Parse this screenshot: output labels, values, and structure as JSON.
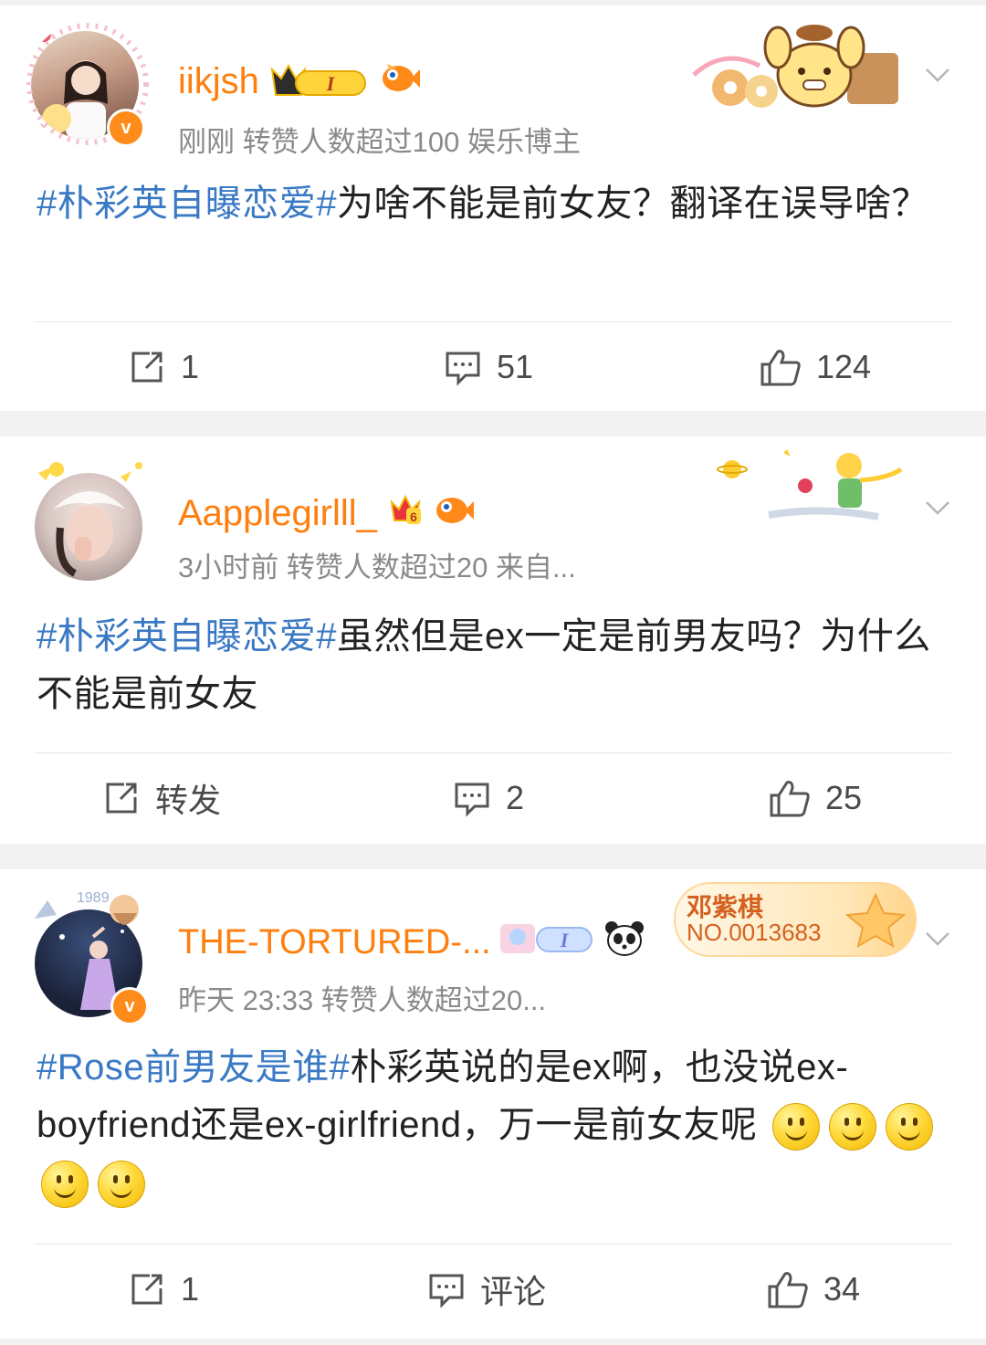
{
  "posts": [
    {
      "username": "iikjsh",
      "meta": "刚刚  转赞人数超过100  娱乐博主",
      "body_tag": "#朴彩英自曝恋爱#",
      "body_text": "为啥不能是前女友？翻译在误导啥？",
      "repost": "1",
      "comments": "51",
      "likes": "124"
    },
    {
      "username": "Aapplegirlll_",
      "meta": "3小时前  转赞人数超过20  来自...",
      "body_tag": "#朴彩英自曝恋爱#",
      "body_text": "虽然但是ex一定是前男友吗？为什么不能是前女友",
      "repost": "转发",
      "comments": "2",
      "likes": "25"
    },
    {
      "username": "THE-TORTURED-...",
      "meta": "昨天 23:33  转赞人数超过20...",
      "fan_badge_name": "邓紫棋",
      "fan_badge_no": "NO.0013683",
      "body_tag": "#Rose前男友是谁#",
      "body_text": "朴彩英说的是ex啊，也没说ex-boyfriend还是ex-girlfriend，万一是前女友呢",
      "repost": "1",
      "comments": "评论",
      "likes": "34"
    }
  ],
  "icons": {
    "repost": "repost-icon",
    "comment": "comment-icon",
    "like": "thumbs-up-icon",
    "more": "chevron-down-icon",
    "verified": "verified-icon"
  },
  "colors": {
    "username": "#ff7f0e",
    "hashtag": "#3a79c4",
    "meta": "#8a8a8a",
    "verified": "#ff8c1a"
  }
}
